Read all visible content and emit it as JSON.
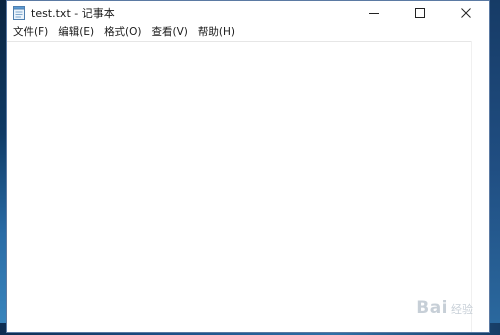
{
  "window": {
    "title": "test.txt - 记事本"
  },
  "menubar": {
    "items": [
      {
        "label": "文件(F)"
      },
      {
        "label": "编辑(E)"
      },
      {
        "label": "格式(O)"
      },
      {
        "label": "查看(V)"
      },
      {
        "label": "帮助(H)"
      }
    ]
  },
  "controls": {
    "minimize_icon": "minimize-icon",
    "maximize_icon": "maximize-icon",
    "close_icon": "close-icon"
  },
  "editor": {
    "content": ""
  },
  "watermark": {
    "text": "Bai",
    "sub": "经验"
  },
  "colors": {
    "window_bg": "#ffffff",
    "desktop": "#1d5d94"
  }
}
